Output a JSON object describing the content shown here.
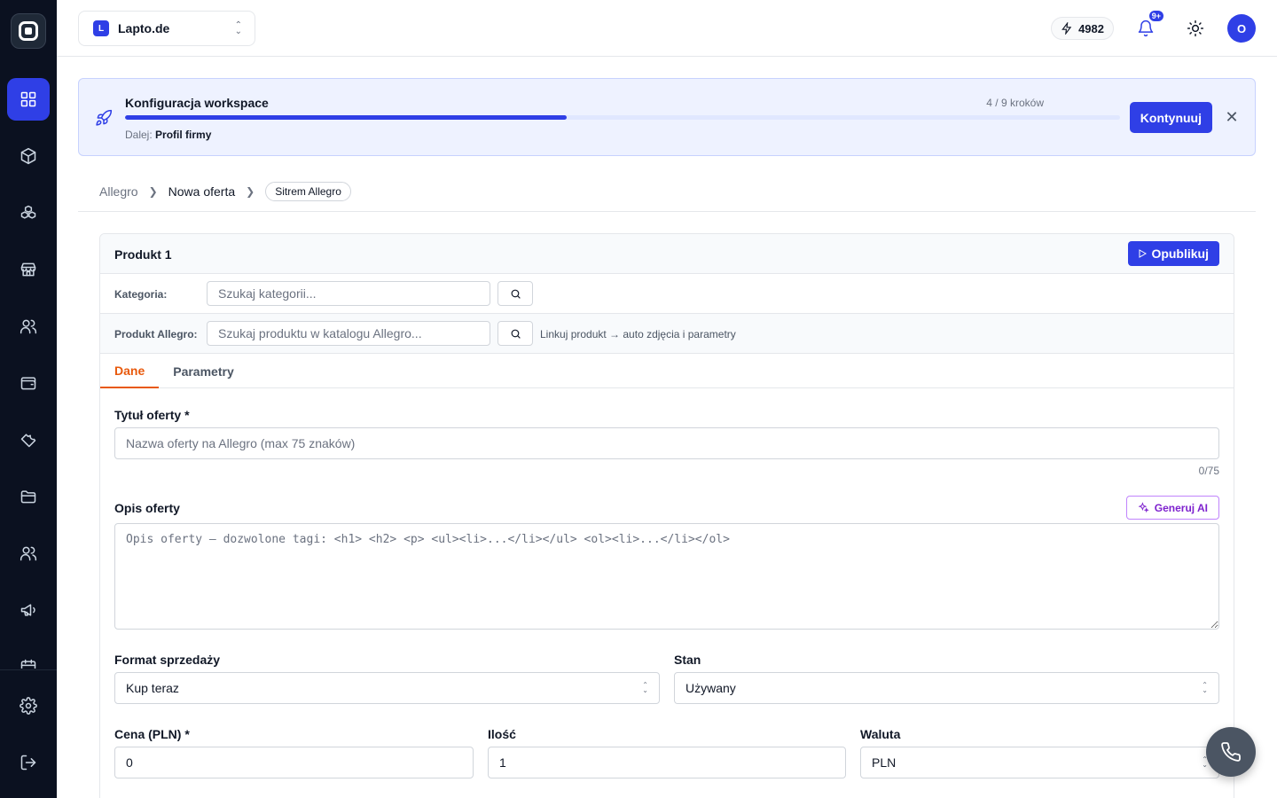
{
  "workspace": {
    "initial": "L",
    "name": "Lapto.de"
  },
  "topbar": {
    "credits": "4982",
    "notifications_badge": "9+",
    "avatar_initial": "O"
  },
  "banner": {
    "title": "Konfiguracja workspace",
    "steps": "4 / 9 kroków",
    "progress_fraction": 0.444,
    "next_label": "Dalej:",
    "next_step": "Profil firmy",
    "continue_label": "Kontynuuj",
    "close_icon": "close-icon"
  },
  "breadcrumb": {
    "items": [
      "Allegro",
      "Nowa oferta"
    ],
    "pill": "Sitrem Allegro"
  },
  "card": {
    "title": "Produkt 1",
    "publish_label": "Opublikuj",
    "category": {
      "label": "Kategoria:",
      "placeholder": "Szukaj kategorii..."
    },
    "product": {
      "label": "Produkt Allegro:",
      "placeholder": "Szukaj produktu w katalogu Allegro...",
      "hint": "Linkuj produkt → auto zdjęcia i parametry"
    },
    "tabs": [
      {
        "label": "Dane",
        "active": true
      },
      {
        "label": "Parametry",
        "active": false
      }
    ],
    "title_field": {
      "label": "Tytuł oferty *",
      "placeholder": "Nazwa oferty na Allegro (max 75 znaków)",
      "counter": "0/75"
    },
    "description": {
      "label": "Opis oferty",
      "ai_label": "Generuj AI",
      "placeholder": "Opis oferty — dozwolone tagi: <h1> <h2> <p> <ul><li>...</li></ul> <ol><li>...</li></ol>"
    },
    "sale_format": {
      "label": "Format sprzedaży",
      "value": "Kup teraz"
    },
    "condition": {
      "label": "Stan",
      "value": "Używany"
    },
    "price": {
      "label": "Cena (PLN) *",
      "value": "0"
    },
    "quantity": {
      "label": "Ilość",
      "value": "1"
    },
    "currency": {
      "label": "Waluta",
      "value": "PLN"
    }
  },
  "colors": {
    "accent": "#2f3fe6",
    "sidebar": "#0b1120",
    "tab_active": "#e8590c",
    "ai": "#7e22ce"
  }
}
